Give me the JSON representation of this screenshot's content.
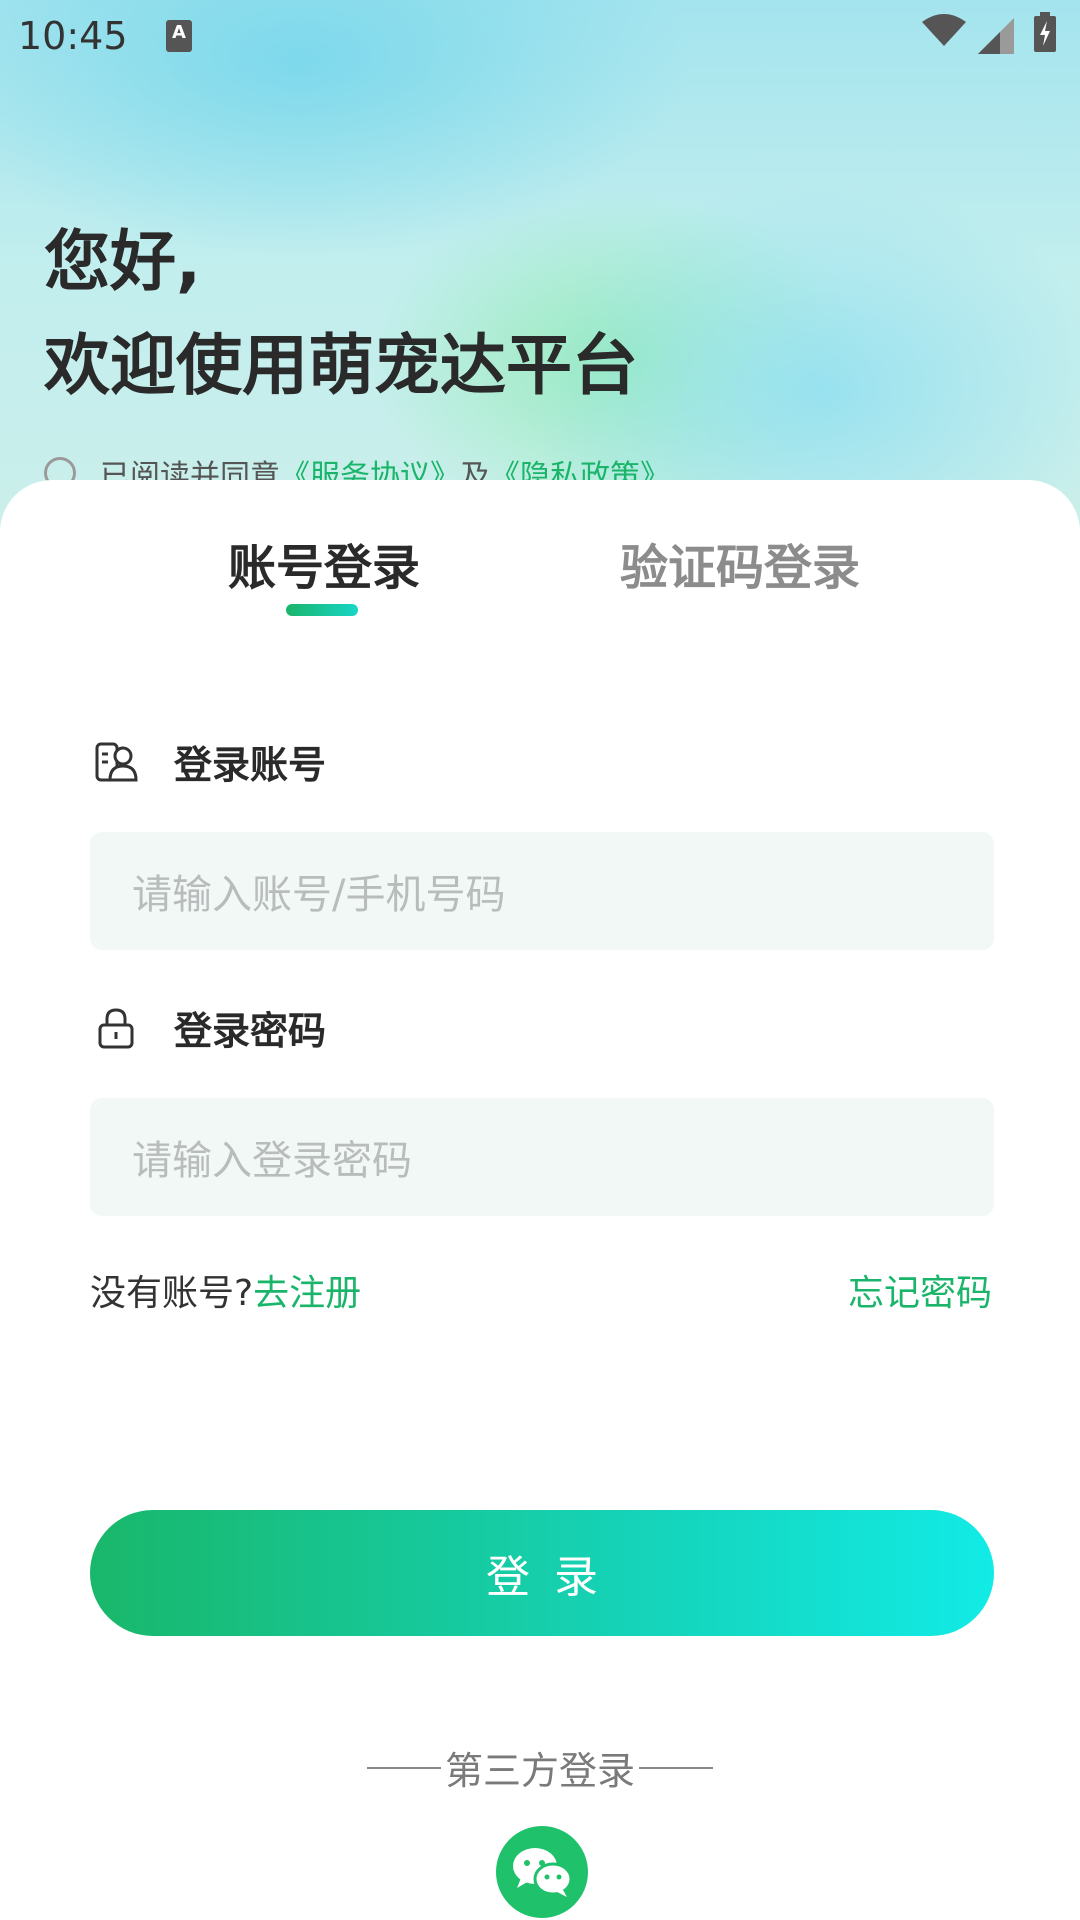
{
  "status_bar": {
    "time": "10:45",
    "notification_icon": "keyboard-a-icon"
  },
  "greeting": {
    "line1": "您好,",
    "line2": "欢迎使用萌宠达平台"
  },
  "agreement": {
    "prefix": "已阅读并同意",
    "service_link": "《服务协议》",
    "conjunction": "及",
    "privacy_link": "《隐私政策》"
  },
  "tabs": [
    {
      "label": "账号登录",
      "active": true
    },
    {
      "label": "验证码登录",
      "active": false
    }
  ],
  "account_field": {
    "label": "登录账号",
    "placeholder": "请输入账号/手机号码",
    "value": ""
  },
  "password_field": {
    "label": "登录密码",
    "placeholder": "请输入登录密码",
    "value": ""
  },
  "register": {
    "prompt": "没有账号?",
    "link": "去注册"
  },
  "forgot_password": "忘记密码",
  "login_button": "登录",
  "third_party": {
    "label": "第三方登录",
    "provider_icon": "wechat-icon"
  },
  "colors": {
    "accent_green": "#1ab46a",
    "button_gradient_start": "#19b76a",
    "button_gradient_end": "#12ebe6",
    "input_bg": "#f1f8f5"
  }
}
